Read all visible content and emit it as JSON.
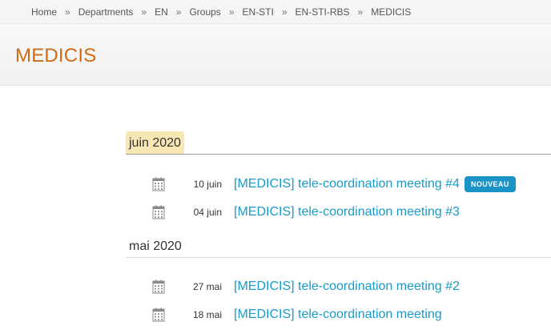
{
  "breadcrumb": {
    "items": [
      "Home",
      "Departments",
      "EN",
      "Groups",
      "EN-STI",
      "EN-STI-RBS",
      "MEDICIS"
    ],
    "separator": "»"
  },
  "page": {
    "title": "MEDICIS"
  },
  "months": [
    {
      "label": "juin 2020",
      "events": [
        {
          "date": "10 juin",
          "title": "[MEDICIS] tele-coordination meeting #4",
          "badge": "NOUVEAU"
        },
        {
          "date": "04 juin",
          "title": "[MEDICIS] tele-coordination meeting #3"
        }
      ]
    },
    {
      "label": "mai 2020",
      "events": [
        {
          "date": "27 mai",
          "title": "[MEDICIS] tele-coordination meeting #2"
        },
        {
          "date": "18 mai",
          "title": "[MEDICIS] tele-coordination meeting"
        }
      ]
    }
  ],
  "colors": {
    "title": "#d06b13",
    "link": "#1a9ac9",
    "badge": "#1a93c6",
    "month_highlight": "#f6e7b4"
  },
  "icons": {
    "event": "calendar-icon"
  }
}
